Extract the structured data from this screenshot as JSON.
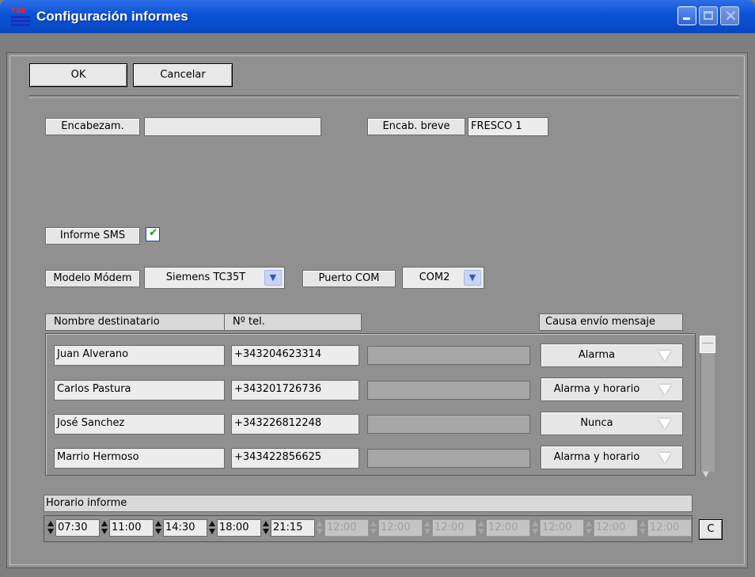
{
  "window": {
    "title": "Configuración informes",
    "icon_text": "TSE"
  },
  "toolbar": {
    "ok_label": "OK",
    "cancel_label": "Cancelar"
  },
  "header_fields": {
    "encabezam_label": "Encabezam.",
    "encabezam_value": "",
    "encab_breve_label": "Encab. breve",
    "encab_breve_value": "FRESCO 1"
  },
  "sms": {
    "label": "Informe SMS",
    "checked": true,
    "check_glyph": "✔"
  },
  "modem": {
    "model_label": "Modelo Módem",
    "model_value": "Siemens TC35T",
    "port_label": "Puerto COM",
    "port_value": "COM2",
    "arrow_glyph": "▼"
  },
  "recipients": {
    "headers": {
      "name": "Nombre destinatario",
      "tel": "Nº tel.",
      "cause": "Causa envío mensaje"
    },
    "rows": [
      {
        "name": "Juan Alverano",
        "tel": "+343204623314",
        "cause": "Alarma"
      },
      {
        "name": "Carlos Pastura",
        "tel": "+343201726736",
        "cause": "Alarma y horario"
      },
      {
        "name": "José Sanchez",
        "tel": "+343226812248",
        "cause": "Nunca"
      },
      {
        "name": "Marrio Hermoso",
        "tel": "+343422856625",
        "cause": "Alarma y horario"
      }
    ]
  },
  "schedule": {
    "label": "Horario informe",
    "times": [
      "07:30",
      "11:00",
      "14:30",
      "18:00",
      "21:15",
      "12:00",
      "12:00",
      "12:00",
      "12:00",
      "12:00",
      "12:00",
      "12:00"
    ],
    "enabled_count": 5,
    "clear_label": "C"
  },
  "icons": {
    "app": "app-logo-icon",
    "minimize": "minimize-icon",
    "maximize": "maximize-icon",
    "close": "close-icon",
    "close_glyph": "✕"
  }
}
